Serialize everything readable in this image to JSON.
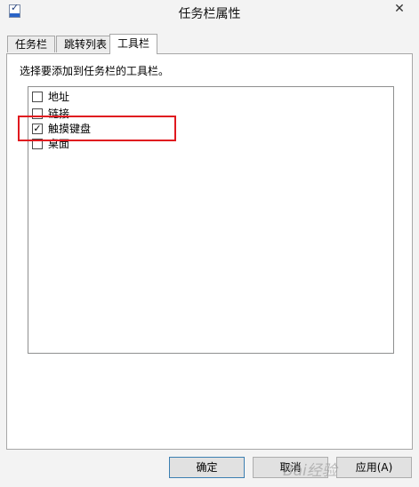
{
  "window": {
    "title": "任务栏属性",
    "close_glyph": "✕"
  },
  "tabs": [
    {
      "label": "任务栏"
    },
    {
      "label": "跳转列表"
    },
    {
      "label": "工具栏"
    }
  ],
  "instruction": "选择要添加到任务栏的工具栏。",
  "toolbars": [
    {
      "label": "地址",
      "checked": false
    },
    {
      "label": "链接",
      "checked": false
    },
    {
      "label": "触摸键盘",
      "checked": true
    },
    {
      "label": "桌面",
      "checked": false
    }
  ],
  "highlight_color": "#e0191f",
  "buttons": {
    "ok": "确定",
    "cancel": "取消",
    "apply": "应用(A)"
  },
  "watermark": "Bai经验"
}
